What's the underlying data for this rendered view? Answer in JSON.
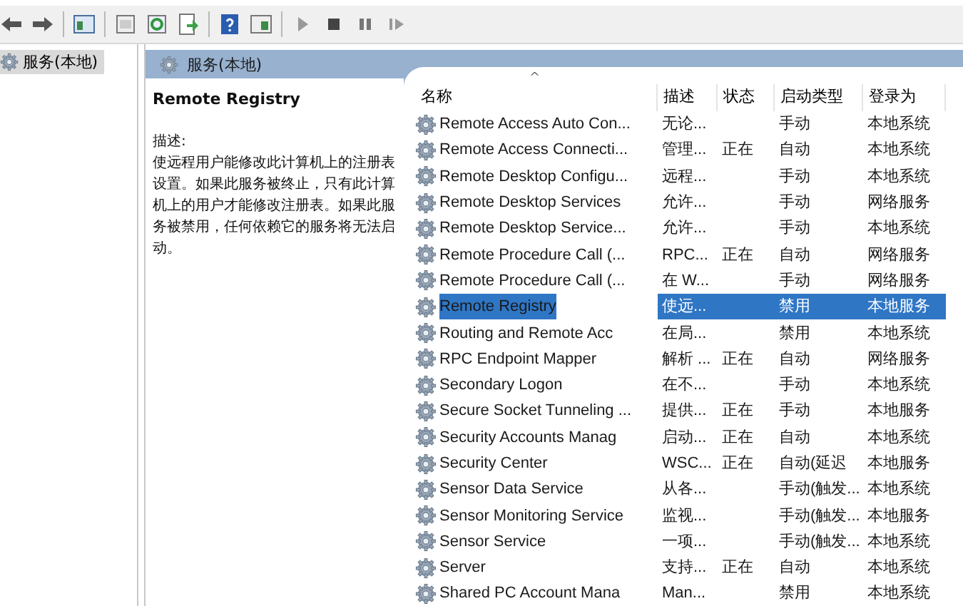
{
  "tree": {
    "items": [
      {
        "label": "服务(本地)",
        "selected": true
      }
    ]
  },
  "pane_header": {
    "title": "服务(本地)"
  },
  "details": {
    "service_name": "Remote Registry",
    "description_label": "描述:",
    "description": "使远程用户能修改此计算机上的注册表设置。如果此服务被终止，只有此计算机上的用户才能修改注册表。如果此服务被禁用，任何依赖它的服务将无法启动。"
  },
  "table": {
    "sort_indicator": "^",
    "columns": [
      "名称",
      "描述",
      "状态",
      "启动类型",
      "登录为"
    ],
    "rows": [
      {
        "cells": [
          "Remote Access Auto Con...",
          "无论...",
          "",
          "手动",
          "本地系统"
        ],
        "selected": false
      },
      {
        "cells": [
          "Remote Access Connecti...",
          "管理...",
          "正在",
          "自动",
          "本地系统"
        ],
        "selected": false
      },
      {
        "cells": [
          "Remote Desktop Configu...",
          "远程...",
          "",
          "手动",
          "本地系统"
        ],
        "selected": false
      },
      {
        "cells": [
          "Remote Desktop Services",
          "允许...",
          "",
          "手动",
          "网络服务"
        ],
        "selected": false
      },
      {
        "cells": [
          "Remote Desktop Service...",
          "允许...",
          "",
          "手动",
          "本地系统"
        ],
        "selected": false
      },
      {
        "cells": [
          "Remote Procedure Call (...",
          "RPC...",
          "正在",
          "自动",
          "网络服务"
        ],
        "selected": false
      },
      {
        "cells": [
          "Remote Procedure Call (...",
          "在 W...",
          "",
          "手动",
          "网络服务"
        ],
        "selected": false
      },
      {
        "cells": [
          "Remote Registry",
          "使远...",
          "",
          "禁用",
          "本地服务"
        ],
        "selected": true
      },
      {
        "cells": [
          "Routing and Remote Acc",
          "在局...",
          "",
          "禁用",
          "本地系统"
        ],
        "selected": false
      },
      {
        "cells": [
          "RPC Endpoint Mapper",
          "解析 ...",
          "正在",
          "自动",
          "网络服务"
        ],
        "selected": false
      },
      {
        "cells": [
          "Secondary Logon",
          "在不...",
          "",
          "手动",
          "本地系统"
        ],
        "selected": false
      },
      {
        "cells": [
          "Secure Socket Tunneling ...",
          "提供...",
          "正在",
          "手动",
          "本地服务"
        ],
        "selected": false
      },
      {
        "cells": [
          "Security Accounts Manag",
          "启动...",
          "正在",
          "自动",
          "本地系统"
        ],
        "selected": false
      },
      {
        "cells": [
          "Security Center",
          "WSC...",
          "正在",
          "自动(延迟",
          "本地服务"
        ],
        "selected": false
      },
      {
        "cells": [
          "Sensor Data Service",
          "从各...",
          "",
          "手动(触发...",
          "本地系统"
        ],
        "selected": false
      },
      {
        "cells": [
          "Sensor Monitoring Service",
          "监视...",
          "",
          "手动(触发...",
          "本地服务"
        ],
        "selected": false
      },
      {
        "cells": [
          "Sensor Service",
          "一项...",
          "",
          "手动(触发...",
          "本地系统"
        ],
        "selected": false
      },
      {
        "cells": [
          "Server",
          "支持...",
          "正在",
          "自动",
          "本地系统"
        ],
        "selected": false
      },
      {
        "cells": [
          "Shared PC Account Mana",
          "Man...",
          "",
          "禁用",
          "本地系统"
        ],
        "selected": false
      }
    ]
  }
}
